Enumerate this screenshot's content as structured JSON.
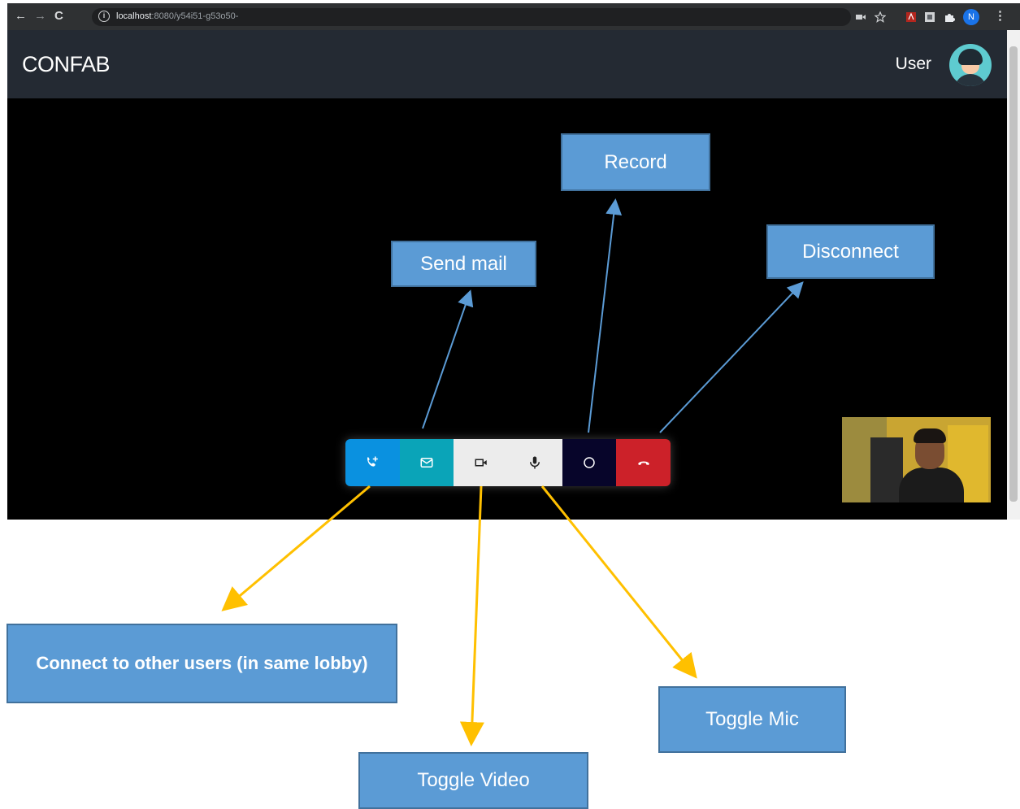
{
  "browser": {
    "url_host": "localhost",
    "url_rest": ":8080/y54i51-g53o50-",
    "icons": [
      "back-icon",
      "forward-icon",
      "reload-icon",
      "info-icon",
      "camera-icon",
      "star-icon",
      "pdf-extension-icon",
      "extension-icon",
      "puzzle-icon",
      "profile-icon",
      "menu-icon"
    ],
    "profile_initial": "N"
  },
  "app": {
    "brand": "CONFAB",
    "user_label": "User"
  },
  "controls": [
    {
      "name": "connect-button",
      "icon": "phone-add-icon",
      "color": "#0a91e0"
    },
    {
      "name": "mail-button",
      "icon": "mail-icon",
      "color": "#0aa4b8"
    },
    {
      "name": "video-toggle-button",
      "icon": "video-icon",
      "color": "#ececec"
    },
    {
      "name": "mic-toggle-button",
      "icon": "mic-icon",
      "color": "#ececec"
    },
    {
      "name": "record-button",
      "icon": "record-icon",
      "color": "#07052a"
    },
    {
      "name": "disconnect-button",
      "icon": "hangup-icon",
      "color": "#cc2129"
    }
  ],
  "annotations": {
    "record": "Record",
    "send_mail": "Send mail",
    "disconnect": "Disconnect",
    "connect": "Connect to other users (in same lobby)",
    "toggle_mic": "Toggle Mic",
    "toggle_video": "Toggle Video"
  },
  "colors": {
    "callout_fill": "#5b9bd5",
    "callout_border": "#41719c",
    "arrow_blue": "#5b9bd5",
    "arrow_yellow": "#ffc000"
  }
}
